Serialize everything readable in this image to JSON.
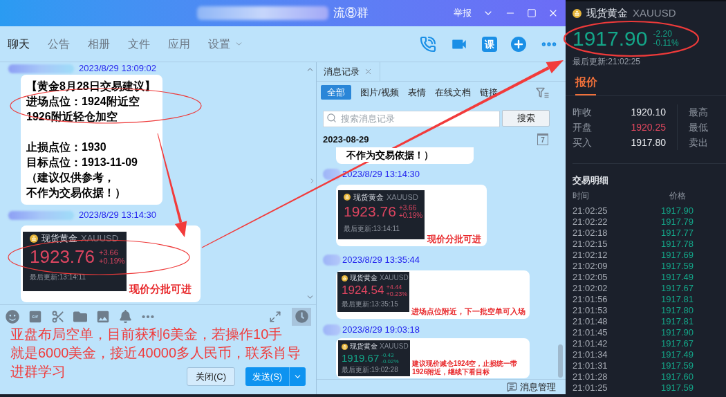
{
  "window": {
    "title": "流⑧群",
    "report": "举报"
  },
  "tabs": [
    {
      "label": "聊天",
      "selected": true,
      "dropdown": false
    },
    {
      "label": "公告",
      "selected": false,
      "dropdown": false
    },
    {
      "label": "相册",
      "selected": false,
      "dropdown": false
    },
    {
      "label": "文件",
      "selected": false,
      "dropdown": false
    },
    {
      "label": "应用",
      "selected": false,
      "dropdown": false
    },
    {
      "label": "设置",
      "selected": false,
      "dropdown": true
    }
  ],
  "header_actions": {
    "course": "课"
  },
  "chat": {
    "messages": [
      {
        "kind": "text",
        "time": "2023/8/29 13:09:02",
        "paragraphs": [
          {
            "lines": [
              "【黄金8月28日交易建议】",
              "进场点位：1924附近空",
              "1926附近轻仓加空"
            ]
          },
          {
            "lines": [
              "止损点位：1930",
              "目标点位：1913-11-09",
              "（建议仅供参考，",
              "不作为交易依据！）"
            ]
          }
        ]
      },
      {
        "kind": "quote",
        "time": "2023/8/29 13:14:30",
        "quote": {
          "name": "现货黄金",
          "symbol": "XAUUSD",
          "price": "1923.76",
          "change": "+3.66",
          "percent": "+0.19%",
          "updated": "最后更新:13:14:11",
          "rising": true
        },
        "caption": "现价分批可进"
      }
    ]
  },
  "composer": {
    "lines": [
      "亚盘布局空单，目前获利6美金，若操作10手",
      "就是6000美金，接近40000多人民币，联系肖导",
      "进群学习"
    ],
    "buttons": [
      {
        "label": "关闭(C)",
        "kind": "secondary"
      },
      {
        "label": "发送(S)",
        "kind": "primary"
      }
    ]
  },
  "history": {
    "tab": "消息记录",
    "filters": [
      {
        "label": "全部",
        "selected": true
      },
      {
        "label": "图片/视频",
        "selected": false
      },
      {
        "label": "表情",
        "selected": false
      },
      {
        "label": "在线文档",
        "selected": false
      },
      {
        "label": "链接",
        "selected": false
      }
    ],
    "search": {
      "placeholder": "搜索消息记录",
      "button": "搜索"
    },
    "date": "2023-08-29",
    "calendar": "7",
    "messages": [
      {
        "kind": "text",
        "paragraphs": [
          {
            "lines": [
              "不作为交易依据！）"
            ]
          }
        ]
      },
      {
        "kind": "quote",
        "time": "2023/8/29 13:14:30",
        "quote": {
          "name": "现货黄金",
          "symbol": "XAUUSD",
          "price": "1923.76",
          "change": "+3.66",
          "percent": "+0.19%",
          "updated": "最后更新:13:14:11",
          "rising": true
        },
        "caption": "现价分批可进"
      },
      {
        "kind": "quote",
        "time": "2023/8/29 13:35:44",
        "quote": {
          "name": "现货黄金",
          "symbol": "XAUUSD",
          "price": "1924.54",
          "change": "+4.44",
          "percent": "+0.23%",
          "updated": "最后更新:13:35:15",
          "rising": true
        },
        "caption": "进场点位附近，下一批空单可入场"
      },
      {
        "kind": "quote",
        "time": "2023/8/29 19:03:18",
        "quote": {
          "name": "现货黄金",
          "symbol": "XAUUSD",
          "price": "1919.67",
          "change": "-0.43",
          "percent": "-0.02%",
          "updated": "最后更新:19:02:28",
          "rising": false
        },
        "caption": "建议现价减仓1924空，止损统一带1926附近，继续下看目标"
      }
    ],
    "footer": "消息管理"
  },
  "quote_panel": {
    "name": "现货黄金",
    "symbol": "XAUUSD",
    "price": "1917.90",
    "change": "-2.20",
    "percent": "-0.11%",
    "rising": false,
    "updated": "最后更新:21:02:25",
    "tabs": [
      {
        "label": "报价",
        "selected": true
      }
    ],
    "stats": [
      {
        "label": "昨收",
        "value": "1920.10",
        "highlighted": false
      },
      {
        "label": "开盘",
        "value": "1920.25",
        "highlighted": true
      },
      {
        "label": "买入",
        "value": "1917.80",
        "highlighted": false
      }
    ],
    "stats_right": [
      {
        "label": "最高"
      },
      {
        "label": "最低"
      },
      {
        "label": "卖出"
      }
    ],
    "trades": {
      "title": "交易明细",
      "columns": [
        "时间",
        "价格"
      ],
      "rows": [
        {
          "time": "21:02:25",
          "price": "1917.90",
          "rising": false
        },
        {
          "time": "21:02:22",
          "price": "1917.79",
          "rising": false
        },
        {
          "time": "21:02:18",
          "price": "1917.77",
          "rising": false
        },
        {
          "time": "21:02:15",
          "price": "1917.78",
          "rising": false
        },
        {
          "time": "21:02:12",
          "price": "1917.69",
          "rising": false
        },
        {
          "time": "21:02:09",
          "price": "1917.59",
          "rising": false
        },
        {
          "time": "21:02:05",
          "price": "1917.49",
          "rising": false
        },
        {
          "time": "21:02:02",
          "price": "1917.67",
          "rising": false
        },
        {
          "time": "21:01:56",
          "price": "1917.81",
          "rising": false
        },
        {
          "time": "21:01:53",
          "price": "1917.80",
          "rising": false
        },
        {
          "time": "21:01:48",
          "price": "1917.81",
          "rising": false
        },
        {
          "time": "21:01:45",
          "price": "1917.90",
          "rising": false
        },
        {
          "time": "21:01:42",
          "price": "1917.67",
          "rising": false
        },
        {
          "time": "21:01:34",
          "price": "1917.49",
          "rising": false
        },
        {
          "time": "21:01:31",
          "price": "1917.59",
          "rising": false
        },
        {
          "time": "21:01:28",
          "price": "1917.60",
          "rising": false
        },
        {
          "time": "21:01:25",
          "price": "1917.59",
          "rising": false
        }
      ]
    }
  }
}
